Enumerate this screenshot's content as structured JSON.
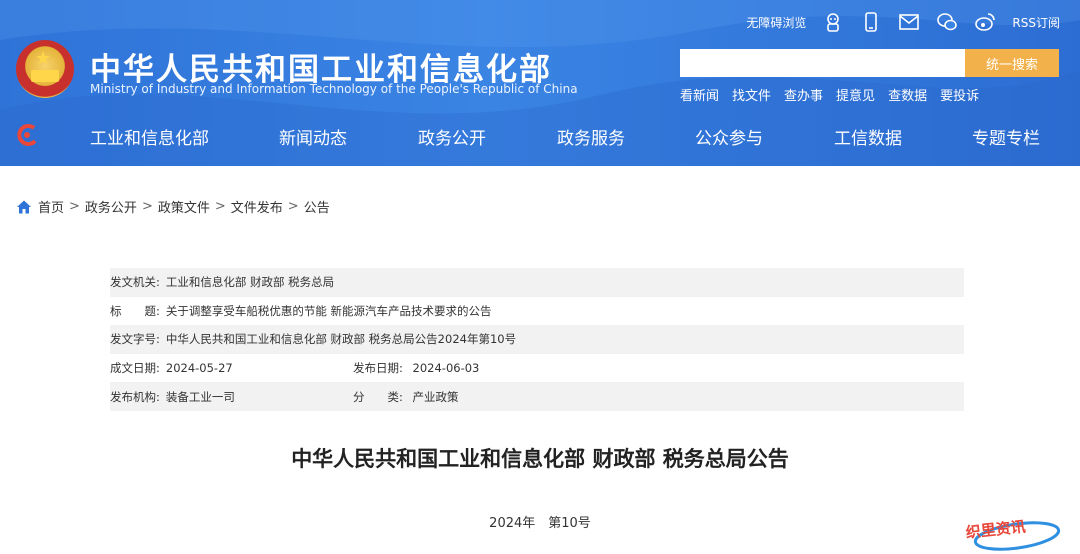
{
  "header": {
    "title": "中华人民共和国工业和信息化部",
    "subtitle": "Ministry of Industry and Information Technology of the People's Republic of China",
    "utility": {
      "accessibility": "无障碍浏览",
      "rss": "RSS订阅",
      "icons": [
        "robot-icon",
        "mobile-icon",
        "mail-icon",
        "wechat-icon",
        "weibo-icon"
      ]
    },
    "search": {
      "value": "",
      "placeholder": "",
      "button_label": "统一搜索"
    },
    "quick_links": [
      "看新闻",
      "找文件",
      "查办事",
      "提意见",
      "查数据",
      "要投诉"
    ],
    "nav": [
      "工业和信息化部",
      "新闻动态",
      "政务公开",
      "政务服务",
      "公众参与",
      "工信数据",
      "专题专栏"
    ]
  },
  "breadcrumb": [
    "首页",
    "政务公开",
    "政策文件",
    "文件发布",
    "公告"
  ],
  "meta": {
    "issuer_label": "发文机关:",
    "issuer": "工业和信息化部 财政部 税务总局",
    "title_label": "标　　题:",
    "title": "关于调整享受车船税优惠的节能 新能源汽车产品技术要求的公告",
    "doc_no_label": "发文字号:",
    "doc_no": "中华人民共和国工业和信息化部 财政部 税务总局公告2024年第10号",
    "created_label": "成文日期:",
    "created": "2024-05-27",
    "published_label": "发布日期:",
    "published": "2024-06-03",
    "org_label": "发布机构:",
    "org": "装备工业一司",
    "category_label": "分　　类:",
    "category": "产业政策"
  },
  "document": {
    "title": "中华人民共和国工业和信息化部 财政部 税务总局公告",
    "number": "2024年　第10号"
  },
  "watermark": {
    "text": "织里资讯"
  },
  "colors": {
    "header_blue": "#3a84e4",
    "search_button": "#f2b14a",
    "row_alt": "#f2f2f2"
  }
}
